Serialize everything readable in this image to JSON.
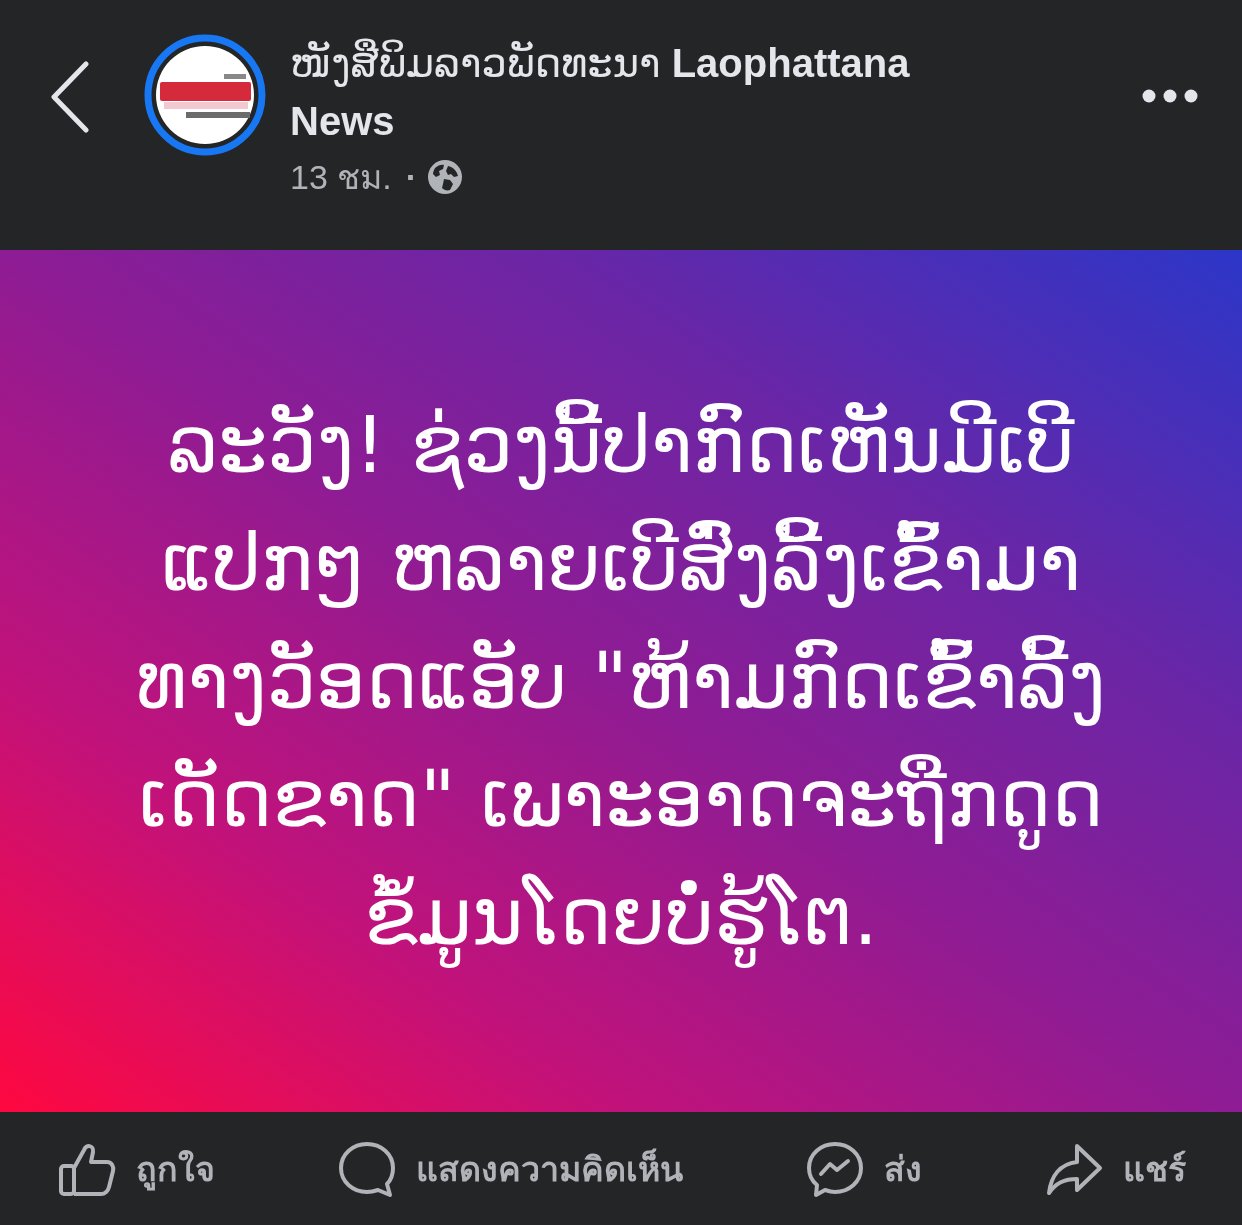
{
  "header": {
    "page": {
      "name": "ໜັງສືພິມລາວພັດທະນາ **Laophattana News**",
      "story_ring": true
    },
    "time": "13 ชม.",
    "separator": "·"
  },
  "post": {
    "text": "ລະວັງ! ຊ່ວງນີ້ປາກົດເຫັນມີເບີ\nແປກໆ ຫລາຍເບີສົ່ງລີ້ງເຂົ້າມາ\nທາງວັອດແອັບ \"ຫ້າມກົດເຂົ້າລີ້ງ\nເດັດຂາດ\" ເພາະອາດຈະຖືກດູດ\nຂໍ້ມູນໂດຍບໍ່ຮູ້ໂຕ."
  },
  "actions": [
    {
      "kind": "like",
      "label": "ถูกใจ"
    },
    {
      "kind": "comment",
      "label": "แสดงความคิดเห็น"
    },
    {
      "kind": "send",
      "label": "ส่ง"
    },
    {
      "kind": "share",
      "label": "แชร์"
    }
  ]
}
